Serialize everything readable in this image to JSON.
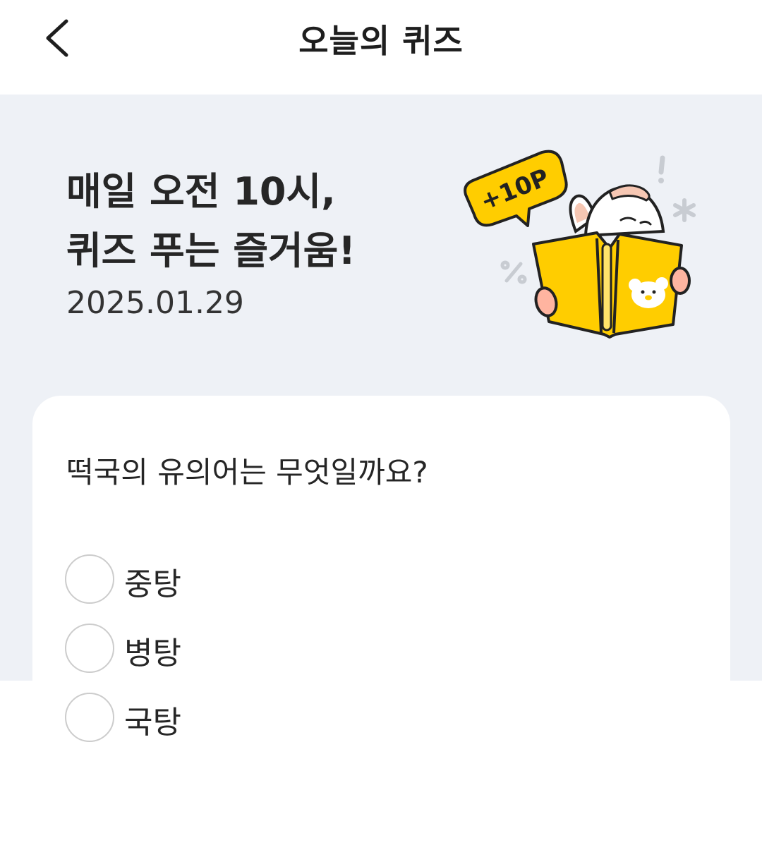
{
  "header": {
    "title": "오늘의 퀴즈",
    "back_icon": "chevron-left-icon"
  },
  "hero": {
    "title_lines": [
      "매일 오전 10시,",
      "퀴즈 푸는 즐거움!"
    ],
    "date": "2025.01.29",
    "badge_text": "+10P"
  },
  "quiz": {
    "question": "떡국의 유의어는 무엇일까요?",
    "options": [
      {
        "label": "중탕",
        "selected": false
      },
      {
        "label": "병탕",
        "selected": false
      },
      {
        "label": "국탕",
        "selected": false
      }
    ]
  },
  "colors": {
    "hero_background": "#eef1f6",
    "accent_yellow": "#ffcd00",
    "radio_border": "#cccccc"
  }
}
